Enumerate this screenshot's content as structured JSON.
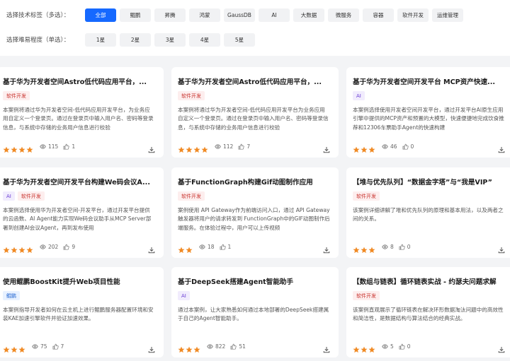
{
  "filters": {
    "tech_label": "选择技术标签（多选）：",
    "tech_tags": [
      "全部",
      "鲲鹏",
      "昇腾",
      "鸿蒙",
      "GaussDB",
      "AI",
      "大数据",
      "微服务",
      "容器",
      "软件开发",
      "运维管理"
    ],
    "tech_active": "全部",
    "level_label": "选择难易程度（单选）：",
    "levels": [
      "1星",
      "2星",
      "3星",
      "4星",
      "5星"
    ]
  },
  "colors": {
    "accent": "#1669ff",
    "star": "#f08a24"
  },
  "cards": [
    {
      "title": "基于华为开发者空间Astro低代码应用平台，...",
      "tags": [
        {
          "label": "软件开发",
          "kind": "dev"
        }
      ],
      "desc": "本案例将通过华为开发者空间-低代码应用开发平台，为业务应用自定义一个登录页。通过在登录页中输入用户名、密码等登录信息，与系统中存储的业务用户信息进行校验",
      "stars": 4,
      "views": "115",
      "likes": "1"
    },
    {
      "title": "基于华为开发者空间Astro低代码应用平台，...",
      "tags": [
        {
          "label": "软件开发",
          "kind": "dev"
        }
      ],
      "desc": "本案例将通过华为开发者空间-低代码应用开发平台为业务应用自定义一个登录页。通过在登录页中输入用户名、密码等登录信息，与系统中存储的业务用户信息进行校验",
      "stars": 4,
      "views": "112",
      "likes": "7"
    },
    {
      "title": "基于华为开发者空间开发平台 MCP资产快速...",
      "tags": [
        {
          "label": "AI",
          "kind": "ai"
        }
      ],
      "desc": "本案例选择使用开发者空间开发平台，通过开发平台AI原生应用引擎中提供的MCP资产和预置的大模型，快速便捷地完成饮食推荐和12306车票助手Agent的快速构建",
      "stars": 3,
      "views": "46",
      "likes": "0"
    },
    {
      "title": "基于华为开发者空间开发平台构建We码会议A...",
      "tags": [
        {
          "label": "AI",
          "kind": "ai"
        },
        {
          "label": "软件开发",
          "kind": "dev"
        }
      ],
      "desc": "本案例选择使用华为开发者空间-开发平台，通过开发平台提供的云函数、AI Agent能力实现We码会议助手从MCP Server部署到创建AI会议Agent，再到发布使用",
      "stars": 4,
      "views": "202",
      "likes": "9"
    },
    {
      "title": "基于FunctionGraph构建Gif动图制作应用",
      "tags": [
        {
          "label": "软件开发",
          "kind": "dev"
        }
      ],
      "desc": "案例使用 API Gateway作为前端访问入口，通过 API Gateway触发器将用户的请求转发到 FunctionGraph中的GIF动图制作后端服务。在体验过程中，用户可以上传视频",
      "stars": 2,
      "views": "18",
      "likes": "1"
    },
    {
      "title": "【堆与优先队列】“数据金字塔”与“我是VIP”",
      "tags": [
        {
          "label": "软件开发",
          "kind": "dev"
        }
      ],
      "desc": "该案例详细讲解了堆和优先队列的原理和基本用法，以及两者之间的关系。",
      "stars": 3,
      "views": "8",
      "likes": "0"
    },
    {
      "title": "使用鲲鹏BoostKit提升Web项目性能",
      "tags": [
        {
          "label": "鲲鹏",
          "kind": "kp"
        }
      ],
      "desc": "本案例指导开发者如何在云主机上进行鲲鹏服务器配置环境和安装KAE加速引擎软件并验证加速效果。",
      "stars": 3,
      "views": "75",
      "likes": "7"
    },
    {
      "title": "基于DeepSeek搭建Agent智能助手",
      "tags": [
        {
          "label": "AI",
          "kind": "ai"
        }
      ],
      "desc": "通过本案例，让大家熟悉如何通过本地部署的DeepSeek搭建属于自己的Agent智能助手。",
      "stars": 3,
      "views": "822",
      "likes": "51"
    },
    {
      "title": "【数组与链表】循环链表实战 - 约瑟夫问题求解",
      "tags": [
        {
          "label": "软件开发",
          "kind": "dev"
        }
      ],
      "desc": "该案例直观展示了循环链表在解决环形数据淘汰问题中的高效性和简洁性，是数据结构与算法结合的经典实战。",
      "stars": 3,
      "views": "5",
      "likes": "0"
    }
  ]
}
